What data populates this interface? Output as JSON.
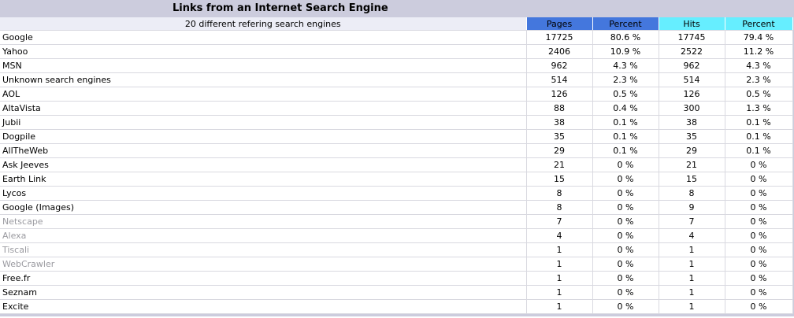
{
  "title": "Links from an Internet Search Engine",
  "subtitle": "20 different refering search engines",
  "columns": {
    "pages": "Pages",
    "percent1": "Percent",
    "hits": "Hits",
    "percent2": "Percent"
  },
  "colors": {
    "pages_header": "#4477dd",
    "hits_header": "#66eeff",
    "frame": "#ccccdd"
  },
  "rows": [
    {
      "engine": "Google",
      "pages": "17725",
      "pages_pct": "80.6 %",
      "hits": "17745",
      "hits_pct": "79.4 %"
    },
    {
      "engine": "Yahoo",
      "pages": "2406",
      "pages_pct": "10.9 %",
      "hits": "2522",
      "hits_pct": "11.2 %"
    },
    {
      "engine": "MSN",
      "pages": "962",
      "pages_pct": "4.3 %",
      "hits": "962",
      "hits_pct": "4.3 %"
    },
    {
      "engine": "Unknown search engines",
      "pages": "514",
      "pages_pct": "2.3 %",
      "hits": "514",
      "hits_pct": "2.3 %"
    },
    {
      "engine": "AOL",
      "pages": "126",
      "pages_pct": "0.5 %",
      "hits": "126",
      "hits_pct": "0.5 %"
    },
    {
      "engine": "AltaVista",
      "pages": "88",
      "pages_pct": "0.4 %",
      "hits": "300",
      "hits_pct": "1.3 %"
    },
    {
      "engine": "Jubii",
      "pages": "38",
      "pages_pct": "0.1 %",
      "hits": "38",
      "hits_pct": "0.1 %"
    },
    {
      "engine": "Dogpile",
      "pages": "35",
      "pages_pct": "0.1 %",
      "hits": "35",
      "hits_pct": "0.1 %"
    },
    {
      "engine": "AllTheWeb",
      "pages": "29",
      "pages_pct": "0.1 %",
      "hits": "29",
      "hits_pct": "0.1 %"
    },
    {
      "engine": "Ask Jeeves",
      "pages": "21",
      "pages_pct": "0 %",
      "hits": "21",
      "hits_pct": "0 %"
    },
    {
      "engine": "Earth Link",
      "pages": "15",
      "pages_pct": "0 %",
      "hits": "15",
      "hits_pct": "0 %"
    },
    {
      "engine": "Lycos",
      "pages": "8",
      "pages_pct": "0 %",
      "hits": "8",
      "hits_pct": "0 %"
    },
    {
      "engine": "Google (Images)",
      "pages": "8",
      "pages_pct": "0 %",
      "hits": "9",
      "hits_pct": "0 %"
    },
    {
      "engine": "Netscape",
      "pages": "7",
      "pages_pct": "0 %",
      "hits": "7",
      "hits_pct": "0 %",
      "faded": true
    },
    {
      "engine": "Alexa",
      "pages": "4",
      "pages_pct": "0 %",
      "hits": "4",
      "hits_pct": "0 %",
      "faded": true
    },
    {
      "engine": "Tiscali",
      "pages": "1",
      "pages_pct": "0 %",
      "hits": "1",
      "hits_pct": "0 %",
      "faded": true
    },
    {
      "engine": "WebCrawler",
      "pages": "1",
      "pages_pct": "0 %",
      "hits": "1",
      "hits_pct": "0 %",
      "faded": true
    },
    {
      "engine": "Free.fr",
      "pages": "1",
      "pages_pct": "0 %",
      "hits": "1",
      "hits_pct": "0 %"
    },
    {
      "engine": "Seznam",
      "pages": "1",
      "pages_pct": "0 %",
      "hits": "1",
      "hits_pct": "0 %"
    },
    {
      "engine": "Excite",
      "pages": "1",
      "pages_pct": "0 %",
      "hits": "1",
      "hits_pct": "0 %"
    }
  ]
}
